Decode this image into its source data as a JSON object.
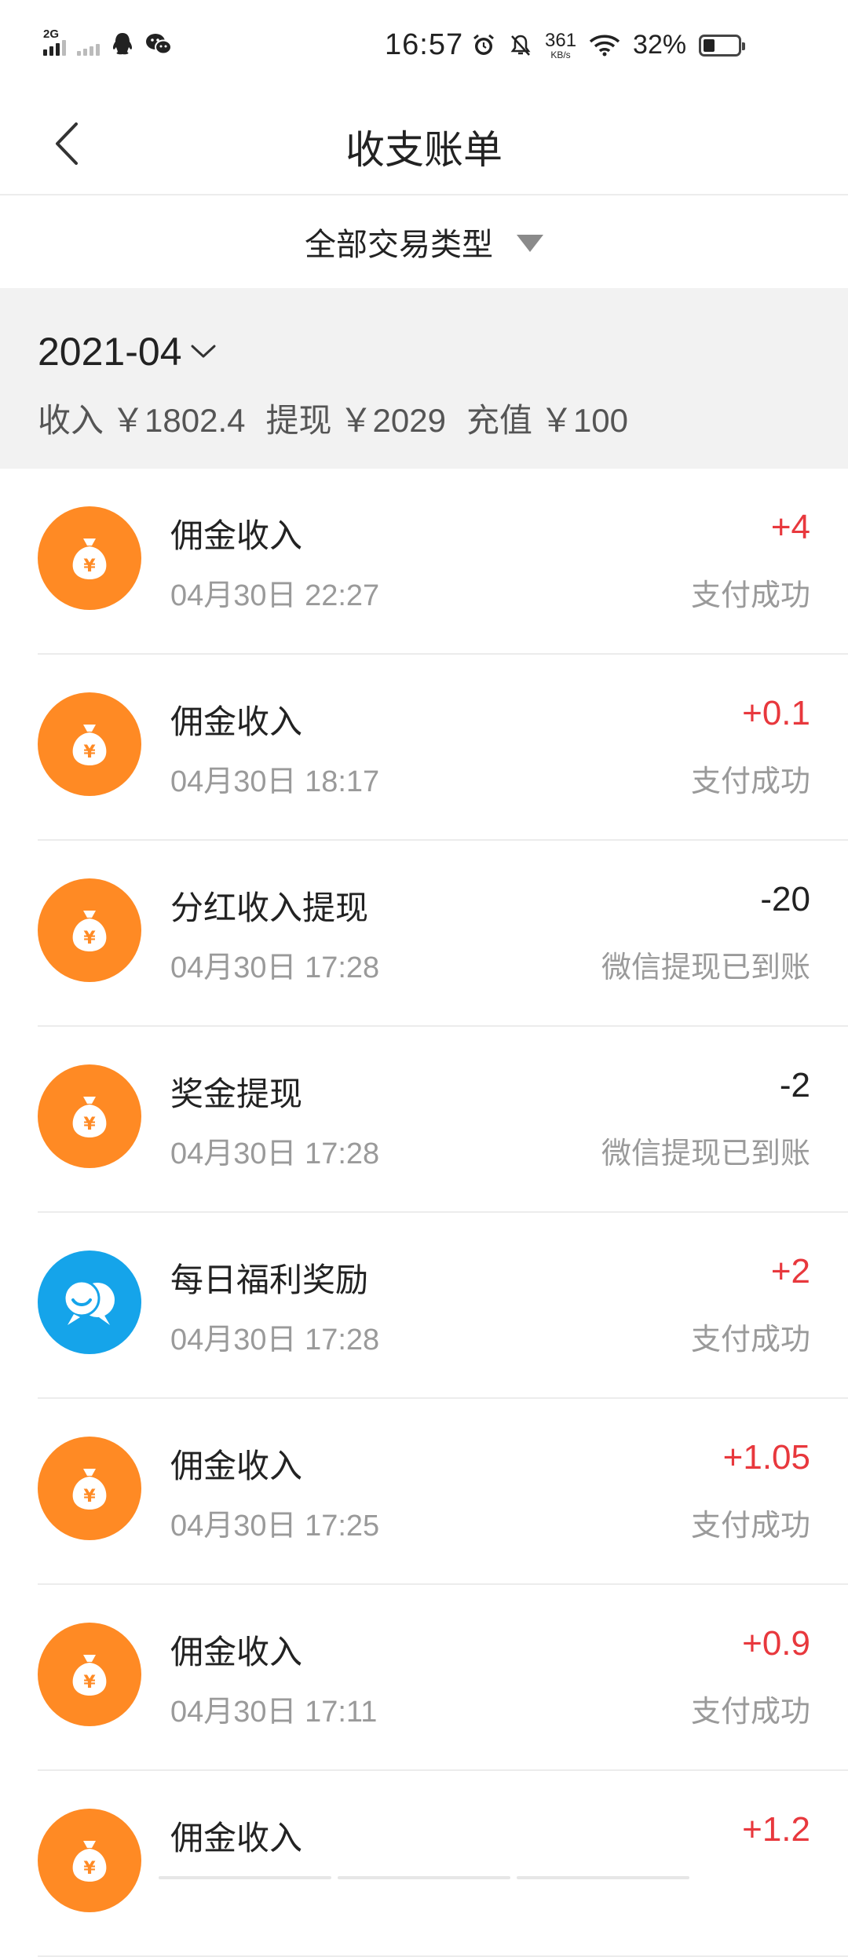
{
  "status_bar": {
    "network": "2G",
    "time": "16:57",
    "net_speed": "361",
    "net_speed_unit": "KB/s",
    "battery_percent": "32%",
    "battery_level": 0.32
  },
  "navbar": {
    "title": "收支账单"
  },
  "filter": {
    "label": "全部交易类型"
  },
  "summary": {
    "month": "2021-04",
    "income_label": "收入",
    "income_value": "￥1802.4",
    "withdraw_label": "提现",
    "withdraw_value": "￥2029",
    "recharge_label": "充值",
    "recharge_value": "￥100"
  },
  "transactions": [
    {
      "title": "佣金收入",
      "time": "04月30日 22:27",
      "amount": "+4",
      "status": "支付成功",
      "icon": "money-bag-icon"
    },
    {
      "title": "佣金收入",
      "time": "04月30日 18:17",
      "amount": "+0.1",
      "status": "支付成功",
      "icon": "money-bag-icon"
    },
    {
      "title": "分红收入提现",
      "time": "04月30日 17:28",
      "amount": "-20",
      "status": "微信提现已到账",
      "icon": "money-bag-icon"
    },
    {
      "title": "奖金提现",
      "time": "04月30日 17:28",
      "amount": "-2",
      "status": "微信提现已到账",
      "icon": "money-bag-icon"
    },
    {
      "title": "每日福利奖励",
      "time": "04月30日 17:28",
      "amount": "+2",
      "status": "支付成功",
      "icon": "chat-bubbles-icon"
    },
    {
      "title": "佣金收入",
      "time": "04月30日 17:25",
      "amount": "+1.05",
      "status": "支付成功",
      "icon": "money-bag-icon"
    },
    {
      "title": "佣金收入",
      "time": "04月30日 17:11",
      "amount": "+0.9",
      "status": "支付成功",
      "icon": "money-bag-icon"
    },
    {
      "title": "佣金收入",
      "time": "",
      "amount": "+1.2",
      "status": "",
      "icon": "money-bag-icon"
    }
  ],
  "colors": {
    "positive": "#e8383d",
    "negative": "#222222",
    "orange_icon": "#ff8a24",
    "blue_icon": "#15a4ea"
  }
}
